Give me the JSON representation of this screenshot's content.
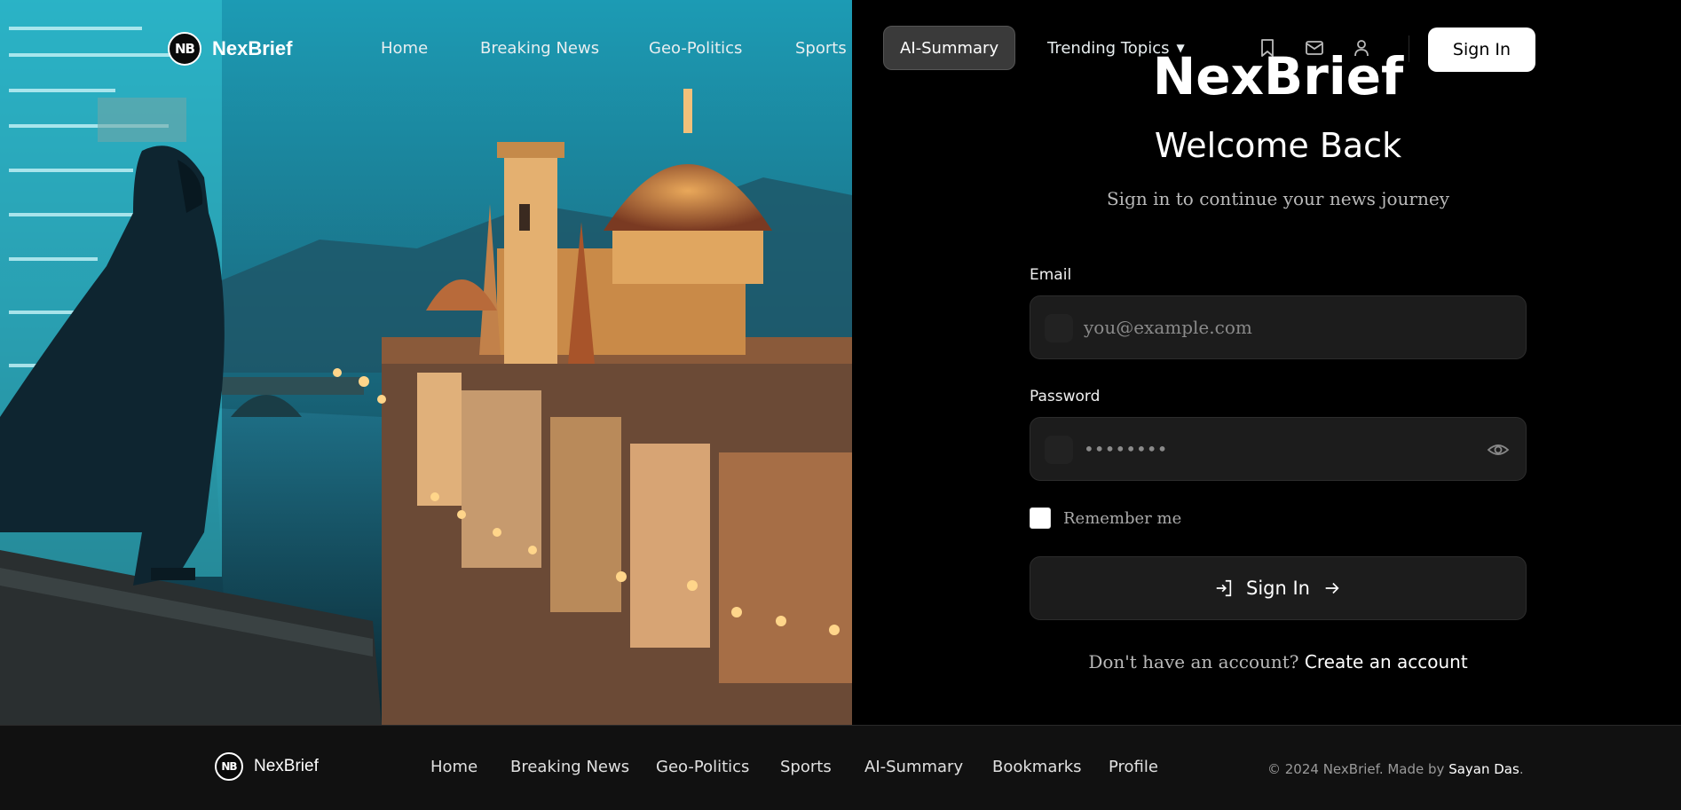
{
  "brand": {
    "name": "NexBrief",
    "logo_text": "NB"
  },
  "nav": {
    "items": [
      {
        "label": "Home"
      },
      {
        "label": "Breaking News"
      },
      {
        "label": "Geo-Politics"
      },
      {
        "label": "Sports"
      },
      {
        "label": "AI-Summary",
        "active": true
      },
      {
        "label": "Trending Topics",
        "has_dropdown": true
      }
    ],
    "icons": [
      "bookmark-icon",
      "mail-icon",
      "user-icon"
    ],
    "signin_label": "Sign In"
  },
  "login": {
    "app_title": "NexBrief",
    "heading": "Welcome Back",
    "subtitle": "Sign in to continue your news journey",
    "email_label": "Email",
    "email_placeholder": "you@example.com",
    "password_label": "Password",
    "password_value": "••••••••",
    "remember_label": "Remember me",
    "submit_label": "Sign In",
    "signup_prompt": "Don't have an account?",
    "signup_link": "Create an account"
  },
  "footer": {
    "brand": "NexBrief",
    "logo_text": "NB",
    "links": [
      "Home",
      "Breaking News",
      "Geo-Politics",
      "Sports",
      "AI-Summary",
      "Bookmarks",
      "Profile"
    ],
    "copyright": "© 2024 NexBrief. Made by",
    "author": "Sayan Das",
    "end": "."
  },
  "colors": {
    "background": "#000000",
    "field_bg": "#1c1c1c",
    "active_nav_bg": "#3a3a3a",
    "footer_bg": "#111111"
  }
}
